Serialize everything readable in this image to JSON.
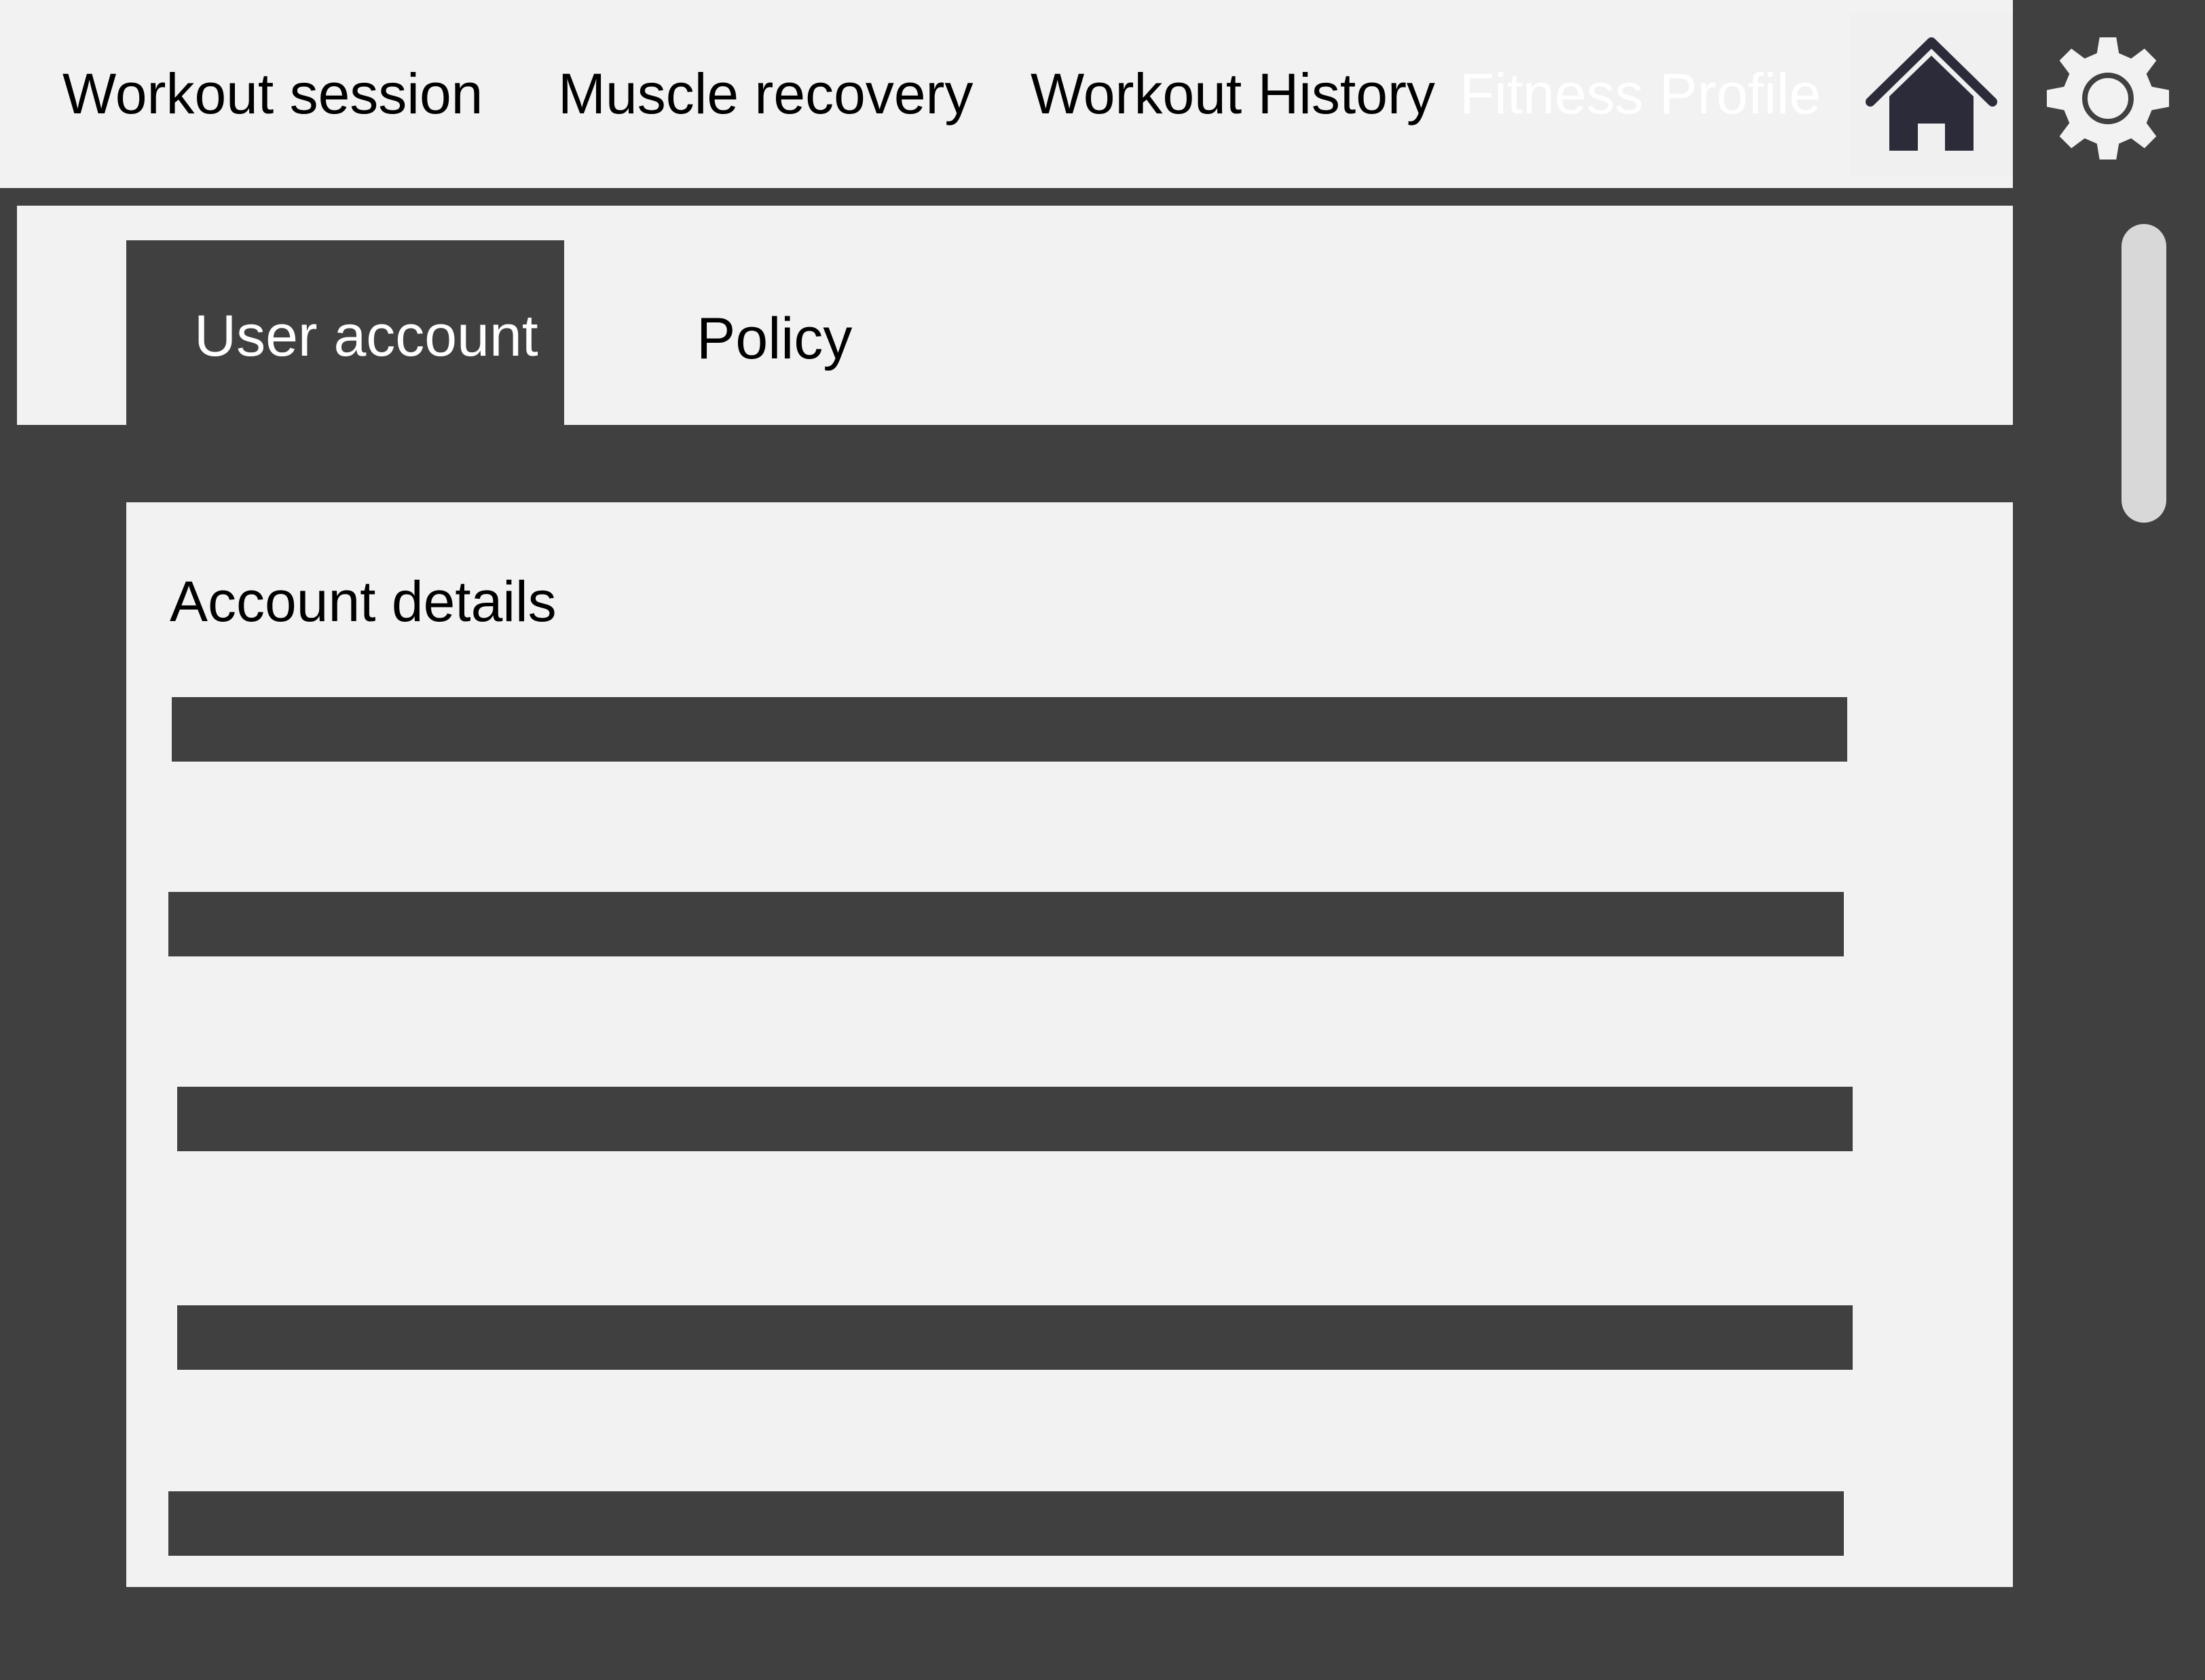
{
  "nav": {
    "items": [
      {
        "label": "Workout session"
      },
      {
        "label": "Muscle recovery"
      },
      {
        "label": "Workout History"
      },
      {
        "label": "Fitness Profile",
        "active": true
      }
    ],
    "home_icon": "home-icon",
    "settings_icon": "gear-icon"
  },
  "tabs": [
    {
      "label": "User account",
      "selected": true
    },
    {
      "label": "Policy",
      "selected": false
    }
  ],
  "card": {
    "title": "Account details",
    "field_count": 5
  },
  "colors": {
    "background": "#404040",
    "panel": "#f2f2f2",
    "nav_text": "#000000",
    "nav_active_text": "#ffffff",
    "home_icon": "#2b2b3a",
    "scrollbar_thumb": "#d8d8d8"
  }
}
